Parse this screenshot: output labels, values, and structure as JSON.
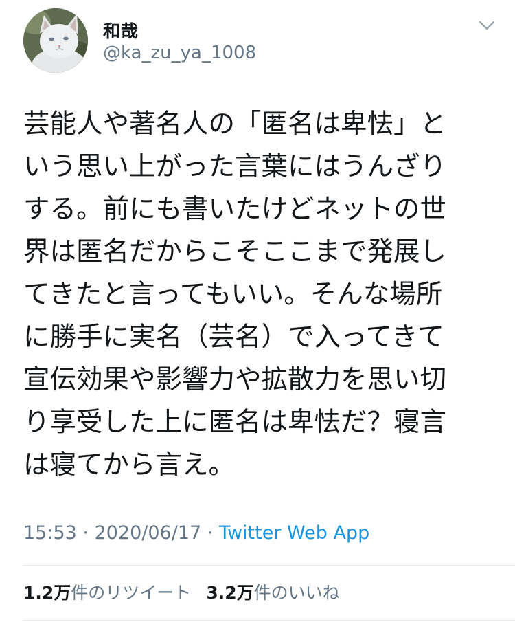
{
  "user": {
    "display_name": "和哉",
    "handle": "@ka_zu_ya_1008"
  },
  "icons": {
    "menu": "chevron-down-icon",
    "avatar": "cat-avatar"
  },
  "tweet": {
    "text": "芸能人や著名人の「匿名は卑怯」と\nいう思い上がった言葉にはうんざり\nする。前にも書いたけどネットの世\n界は匿名だからこそここまで発展し\nてきたと言ってもいい。そんな場所\nに勝手に実名（芸名）で入ってきて\n宣伝効果や影響力や拡散力を思い切\nり享受した上に匿名は卑怯だ？寝言\nは寝てから言え。",
    "time": "15:53",
    "separator": " · ",
    "date": "2020/06/17",
    "source": "Twitter Web App"
  },
  "stats": {
    "retweet_count": "1.2万",
    "retweet_label": "件のリツイート",
    "like_count": "3.2万",
    "like_label": "件のいいね"
  },
  "colors": {
    "text": "#14171a",
    "secondary": "#657786",
    "link": "#1b95e0",
    "divider": "#e1e8ed"
  }
}
